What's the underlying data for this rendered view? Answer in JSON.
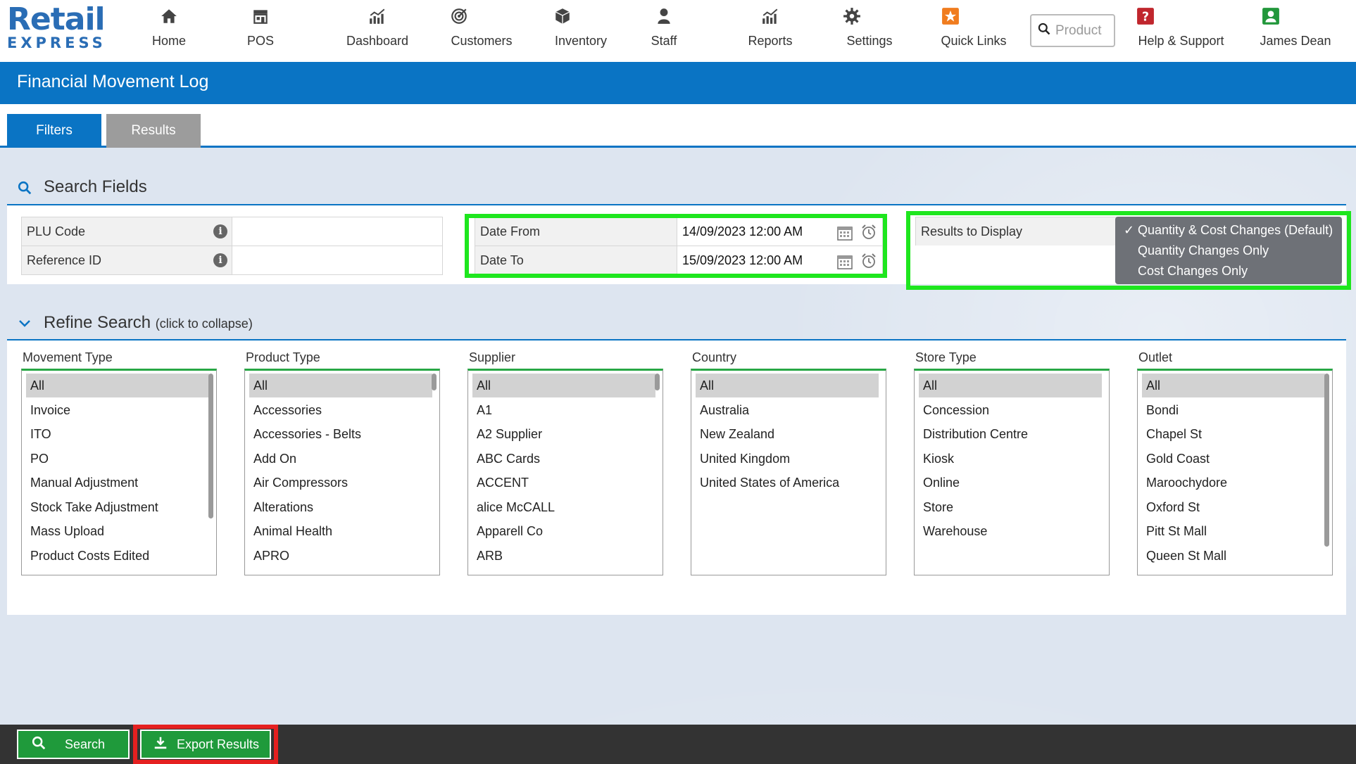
{
  "app": {
    "logo_line1": "Retail",
    "logo_line2": "EXPRESS"
  },
  "nav": {
    "items": [
      {
        "label": "Home",
        "icon": "home-icon"
      },
      {
        "label": "POS",
        "icon": "store-icon"
      },
      {
        "label": "Dashboard",
        "icon": "dashboard-chart-icon"
      },
      {
        "label": "Customers",
        "icon": "target-icon"
      },
      {
        "label": "Inventory",
        "icon": "box-icon"
      },
      {
        "label": "Staff",
        "icon": "person-icon"
      },
      {
        "label": "Reports",
        "icon": "reports-chart-icon"
      },
      {
        "label": "Settings",
        "icon": "gear-icon"
      },
      {
        "label": "Quick Links",
        "icon": "star-icon"
      },
      {
        "label": "Help & Support",
        "icon": "help-icon"
      },
      {
        "label": "James Dean",
        "icon": "user-icon"
      }
    ],
    "search_placeholder": "Product"
  },
  "page": {
    "title": "Financial Movement Log",
    "tabs": [
      {
        "label": "Filters",
        "active": true
      },
      {
        "label": "Results",
        "active": false
      }
    ]
  },
  "search_fields": {
    "heading": "Search Fields",
    "plu_code": {
      "label": "PLU Code",
      "value": ""
    },
    "reference_id": {
      "label": "Reference ID",
      "value": ""
    },
    "date_from": {
      "label": "Date From",
      "value": "14/09/2023 12:00 AM"
    },
    "date_to": {
      "label": "Date To",
      "value": "15/09/2023 12:00 AM"
    },
    "results_to_display": {
      "label": "Results to Display",
      "options": [
        "Quantity & Cost Changes (Default)",
        "Quantity Changes Only",
        "Cost Changes Only"
      ],
      "selected": "Quantity & Cost Changes (Default)",
      "check_mark": "✓"
    }
  },
  "refine_search": {
    "heading": "Refine Search",
    "hint": "(click to collapse)",
    "lists": [
      {
        "title": "Movement Type",
        "options": [
          "All",
          "Invoice",
          "ITO",
          "PO",
          "Manual Adjustment",
          "Stock Take Adjustment",
          "Mass Upload",
          "Product Costs Edited"
        ]
      },
      {
        "title": "Product Type",
        "options": [
          "All",
          "Accessories",
          "Accessories - Belts",
          "Add On",
          "Air Compressors",
          "Alterations",
          "Animal Health",
          "APRO"
        ]
      },
      {
        "title": "Supplier",
        "options": [
          "All",
          "A1",
          "A2 Supplier",
          "ABC Cards",
          "ACCENT",
          "alice McCALL",
          "Apparell Co",
          "ARB"
        ]
      },
      {
        "title": "Country",
        "options": [
          "All",
          "Australia",
          "New Zealand",
          "United Kingdom",
          "United States of America"
        ]
      },
      {
        "title": "Store Type",
        "options": [
          "All",
          "Concession",
          "Distribution Centre",
          "Kiosk",
          "Online",
          "Store",
          "Warehouse"
        ]
      },
      {
        "title": "Outlet",
        "options": [
          "All",
          "Bondi",
          "Chapel St",
          "Gold Coast",
          "Maroochydore",
          "Oxford St",
          "Pitt St Mall",
          "Queen St Mall"
        ]
      }
    ]
  },
  "actions": {
    "search_label": "Search",
    "export_label": "Export Results"
  },
  "colors": {
    "brand_blue": "#0a74c4",
    "action_green": "#1f9a3b",
    "highlight_green": "#1ee61e",
    "highlight_red": "#e52020"
  }
}
